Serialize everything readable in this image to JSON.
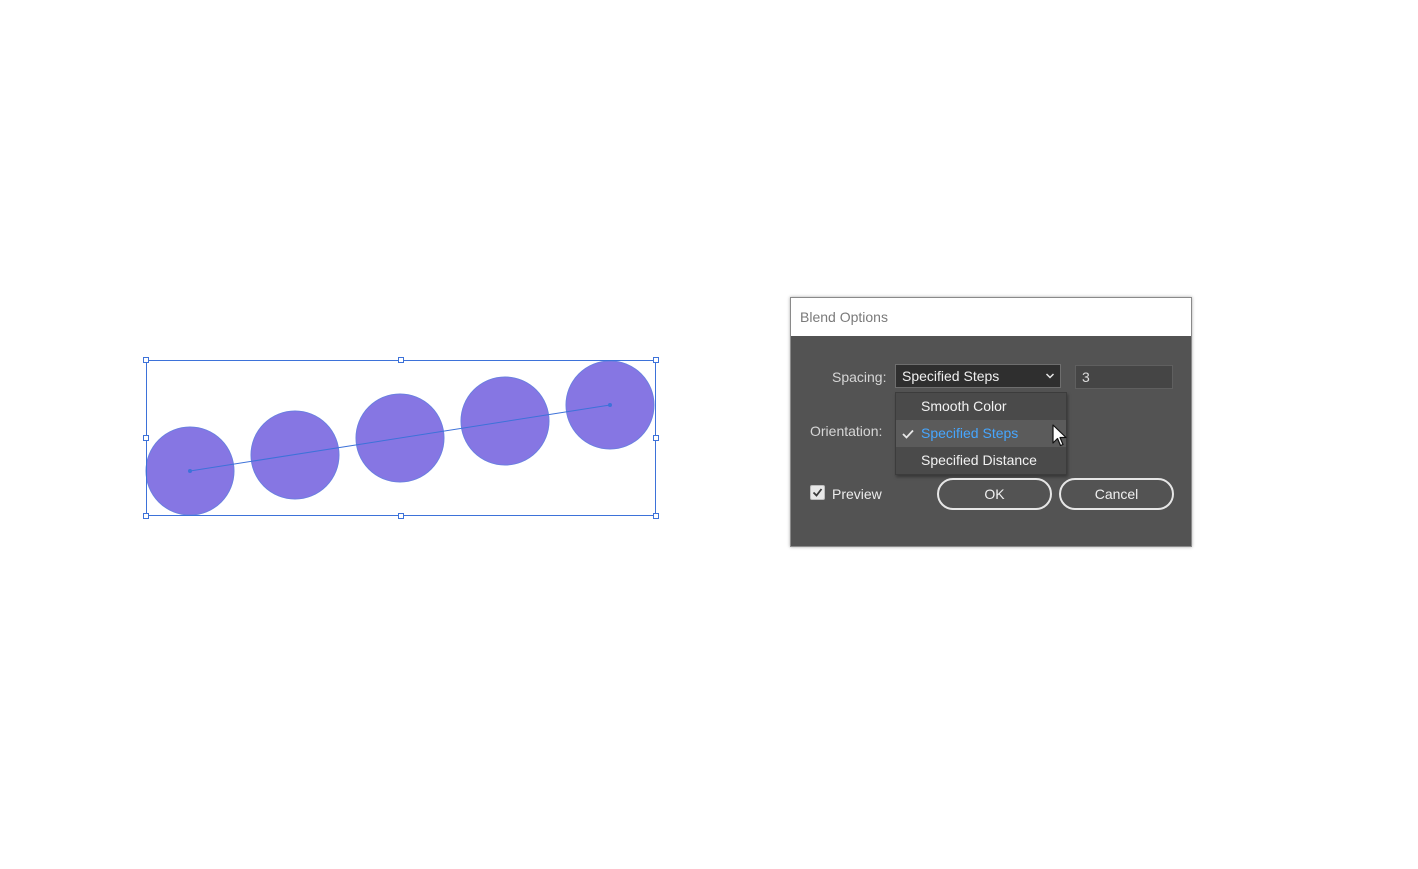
{
  "dialog": {
    "title": "Blend Options",
    "spacing_label": "Spacing:",
    "spacing_selected": "Specified Steps",
    "steps_value": "3",
    "orientation_label": "Orientation:",
    "dropdown_options": [
      {
        "label": "Smooth Color",
        "checked": false
      },
      {
        "label": "Specified Steps",
        "checked": true
      },
      {
        "label": "Specified Distance",
        "checked": false
      }
    ],
    "preview_label": "Preview",
    "preview_checked": true,
    "ok_label": "OK",
    "cancel_label": "Cancel"
  },
  "artwork": {
    "circle_count": 5,
    "circle_fill": "#8676e3",
    "circle_stroke": "#6b7fe0",
    "selection_color": "#3d72d9"
  },
  "colors": {
    "dialog_bg": "#535353",
    "highlight_text": "#46a6ff"
  }
}
